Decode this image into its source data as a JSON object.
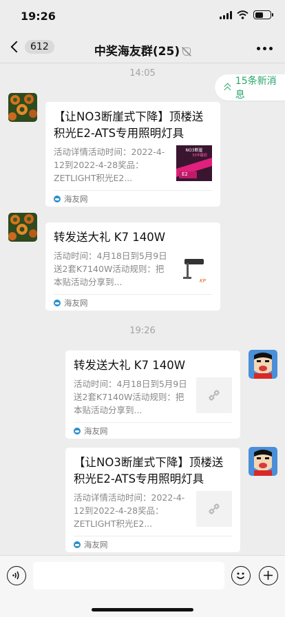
{
  "status": {
    "time": "19:26"
  },
  "nav": {
    "back_count": "612",
    "title": "中奖海友群(25)"
  },
  "new_messages": "15条新消息",
  "timestamps": [
    "14:05",
    "19:26"
  ],
  "messages": [
    {
      "side": "left",
      "title": "【让NO3断崖式下降】顶楼送积光E2-ATS专用照明灯具",
      "desc": "活动详情活动时间：2022-4-12到2022-4-28奖品：ZETLIGHT积光E2...",
      "source": "海友网",
      "thumb_text": "NO3断崖\n50丰覆铜\nE2"
    },
    {
      "side": "left",
      "title": "转发送大礼 K7 140W",
      "desc": "活动时间：4月18日到5月9日送2套K7140W活动规则：把本贴活动分享到...",
      "source": "海友网",
      "thumb_text": "KP"
    },
    {
      "side": "right",
      "title": "转发送大礼 K7 140W",
      "desc": "活动时间：4月18日到5月9日送2套K7140W活动规则：把本贴活动分享到...",
      "source": "海友网"
    },
    {
      "side": "right",
      "title": "【让NO3断崖式下降】顶楼送积光E2-ATS专用照明灯具",
      "desc": "活动详情活动时间：2022-4-12到2022-4-28奖品：ZETLIGHT积光E2...",
      "source": "海友网"
    }
  ],
  "colors": {
    "background": "#ededed",
    "accent_green": "#27a56a",
    "card": "#ffffff"
  }
}
